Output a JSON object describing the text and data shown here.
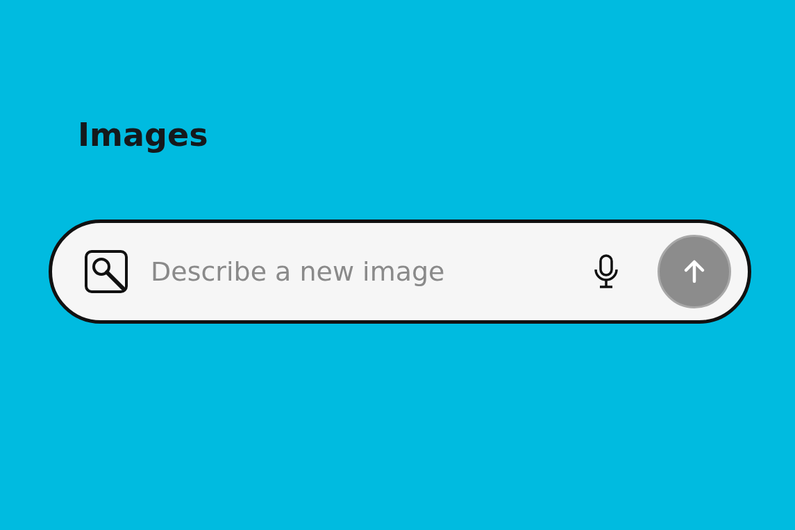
{
  "title": "Images",
  "prompt_bar": {
    "placeholder": "Describe a new image",
    "send_button": {
      "disabled": true
    }
  }
}
